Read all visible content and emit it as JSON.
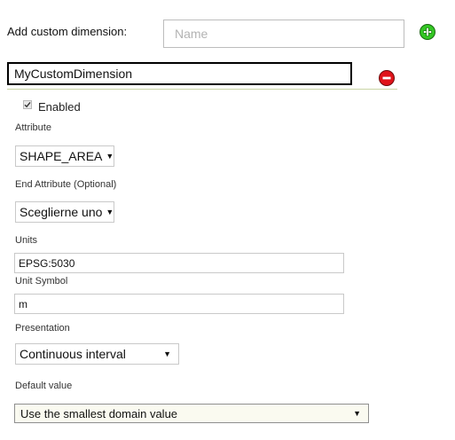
{
  "add_dimension": {
    "label": "Add custom dimension:",
    "name_placeholder": "Name",
    "add_icon": "plus-circle-icon"
  },
  "dimension": {
    "name_value": "MyCustomDimension",
    "remove_icon": "minus-circle-icon",
    "enabled_label": "Enabled",
    "enabled_checked": true,
    "attribute": {
      "label": "Attribute",
      "value": "SHAPE_AREA"
    },
    "end_attribute": {
      "label": "End Attribute (Optional)",
      "value": "Sceglierne uno"
    },
    "units": {
      "label": "Units",
      "value": "EPSG:5030"
    },
    "unit_symbol": {
      "label": "Unit Symbol",
      "value": "m"
    },
    "presentation": {
      "label": "Presentation",
      "value": "Continuous interval"
    },
    "default_value": {
      "label": "Default value",
      "value": "Use the smallest domain value"
    }
  },
  "colors": {
    "add_green": "#34c724",
    "remove_red": "#e0131a",
    "underline": "#c9d5a6"
  }
}
